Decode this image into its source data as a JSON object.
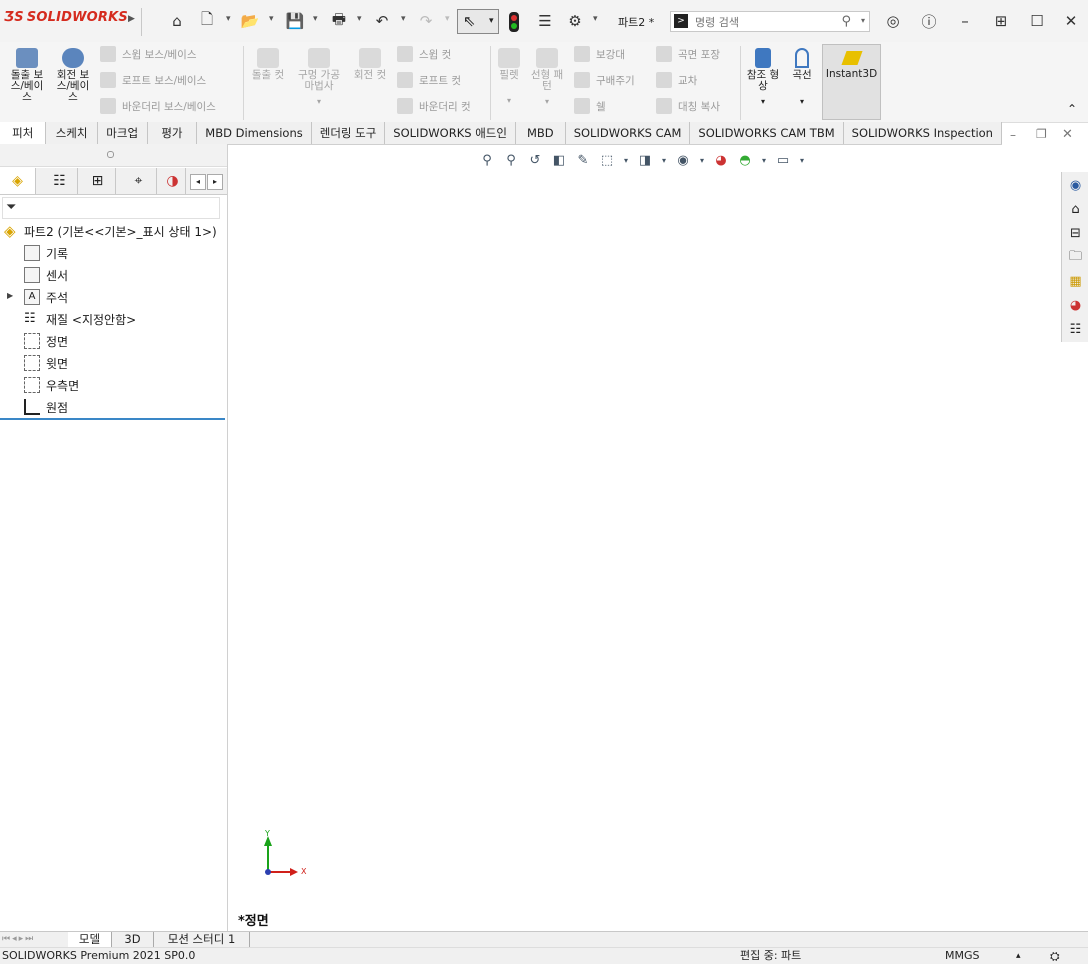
{
  "app": {
    "brand": "SOLIDWORKS",
    "document_name": "파트2 *"
  },
  "search": {
    "placeholder": "명령 검색"
  },
  "ribbon": {
    "extruded_boss": "돌출 보스/베이스",
    "revolved_boss": "회전 보스/베이스",
    "swept_boss": "스윕 보스/베이스",
    "lofted_boss": "로프트 보스/베이스",
    "boundary_boss": "바운더리 보스/베이스",
    "extruded_cut": "돌출 컷",
    "hole_wizard": "구멍 가공 마법사",
    "revolved_cut": "회전 컷",
    "swept_cut": "스윕 컷",
    "lofted_cut": "로프트 컷",
    "boundary_cut": "바운더리 컷",
    "fillet": "필렛",
    "linear_pattern": "선형 패턴",
    "rib": "보강대",
    "draft": "구배주기",
    "shell": "쉘",
    "wrap": "곡면 포장",
    "intersect": "교차",
    "mirror": "대칭 복사",
    "ref_geometry": "참조 형상",
    "curves": "곡선",
    "instant3d": "Instant3D"
  },
  "tabs": [
    {
      "label": "피처"
    },
    {
      "label": "스케치"
    },
    {
      "label": "마크업"
    },
    {
      "label": "평가"
    },
    {
      "label": "MBD Dimensions"
    },
    {
      "label": "렌더링 도구"
    },
    {
      "label": "SOLIDWORKS 애드인"
    },
    {
      "label": "MBD"
    },
    {
      "label": "SOLIDWORKS CAM"
    },
    {
      "label": "SOLIDWORKS CAM TBM"
    },
    {
      "label": "SOLIDWORKS Inspection"
    }
  ],
  "tree": {
    "root": "파트2  (기본<<기본>_표시 상태 1>)",
    "items": [
      {
        "label": "기록"
      },
      {
        "label": "센서"
      },
      {
        "label": "주석"
      },
      {
        "label": "재질 <지정안함>"
      },
      {
        "label": "정면"
      },
      {
        "label": "윗면"
      },
      {
        "label": "우측면"
      },
      {
        "label": "원점"
      }
    ]
  },
  "viewport": {
    "view_name": "*정면",
    "triad_y": "Y",
    "triad_x": "X"
  },
  "bottom_tabs": [
    {
      "label": "모델"
    },
    {
      "label": "3D 뷰"
    },
    {
      "label": "모션 스터디 1"
    }
  ],
  "status": {
    "product": "SOLIDWORKS Premium 2021 SP0.0",
    "mode": "편집 중: 파트",
    "units": "MMGS"
  },
  "colors": {
    "brand_red": "#d52b1e",
    "accent_blue": "#3a87c7",
    "triad_green": "#1aa31a",
    "triad_red": "#d0201a"
  }
}
